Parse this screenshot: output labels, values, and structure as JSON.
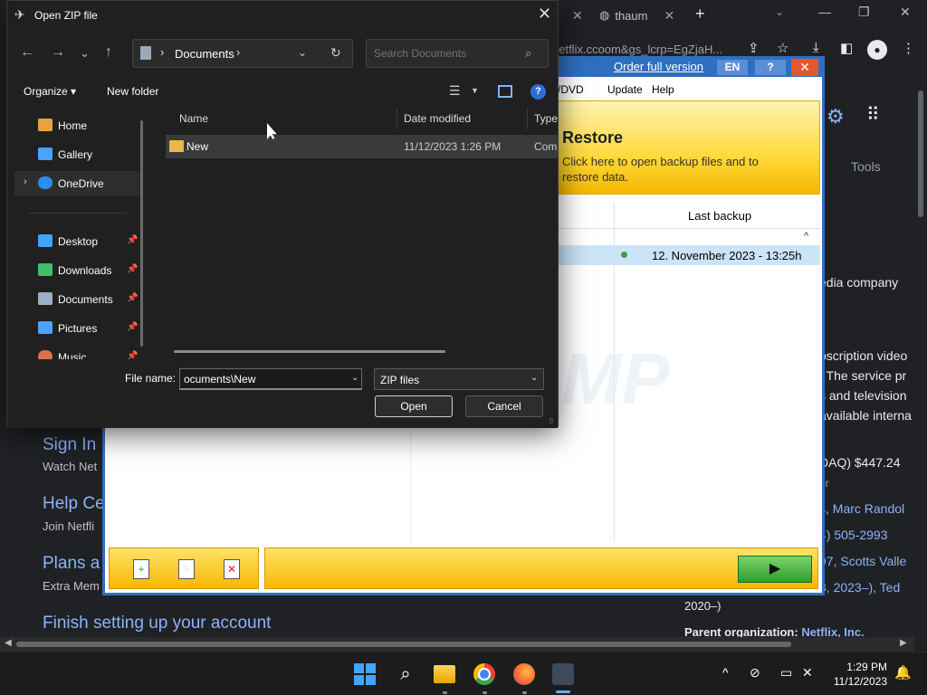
{
  "browser": {
    "tab_x1": "✕",
    "tab_name": "thaum",
    "tab_x2": "✕",
    "new_tab": "+",
    "chevron": "⌄",
    "omnibox": "netflix.ccoom&gs_lcrp=EgZjaH...",
    "win_min": "—",
    "win_max": "❐",
    "win_close": "✕"
  },
  "page": {
    "tools": "Tools",
    "right_texts": [
      "edia company",
      "bscription video",
      ". The service pr",
      "s and television",
      "available interna",
      "DAQ)  $447.24",
      "er",
      "s, Marc Randol",
      "4) 505-2993",
      "97, Scotts Valle",
      "3, 2023–), Ted"
    ],
    "sign_in": "Sign In",
    "sign_in_sub": "Watch Net",
    "help": "Help Ce",
    "help_sub": "Join Netfli",
    "plans": "Plans a",
    "plans_sub": "Extra Mem",
    "finish": "Finish setting up your account",
    "wiki_year": "2020–)",
    "parent_label": "Parent organization:",
    "parent_value": "Netflix, Inc."
  },
  "backup_app": {
    "order_link": "Order full version",
    "lang": "EN",
    "help": "?",
    "close": "✕",
    "menu": [
      "/DVD",
      "Update",
      "Help"
    ],
    "restore_title": "Restore",
    "restore_desc": "Click here to open backup files and to restore data.",
    "col_last_backup": "Last backup",
    "row_last_backup": "12. November 2023 - 13:25h",
    "watermark": "MP",
    "play": "▶"
  },
  "dialog": {
    "title": "Open ZIP file",
    "close": "✕",
    "nav": {
      "back": "←",
      "forward": "→",
      "recent": "⌄",
      "up": "↑"
    },
    "address": {
      "sep": "›",
      "folder": "Documents",
      "dropdown": "⌄",
      "refresh": "↻"
    },
    "search_placeholder": "Search Documents",
    "search_icon": "⌕",
    "organize": "Organize ▾",
    "new_folder": "New folder",
    "help": "?",
    "nav_pane": [
      {
        "label": "Home",
        "color": "#e8a33c"
      },
      {
        "label": "Gallery",
        "color": "#4aa3ff"
      },
      {
        "label": "OneDrive",
        "color": "#2d8cf0",
        "selected": true
      },
      {
        "label": "Desktop",
        "color": "#3ea6ff",
        "pinned": true
      },
      {
        "label": "Downloads",
        "color": "#3fbf6a",
        "pinned": true
      },
      {
        "label": "Documents",
        "color": "#9ab0c8",
        "pinned": true
      },
      {
        "label": "Pictures",
        "color": "#4aa3ff",
        "pinned": true
      },
      {
        "label": "Music",
        "color": "#e0704a",
        "pinned": true
      }
    ],
    "columns": {
      "name": "Name",
      "date": "Date modified",
      "type": "Type"
    },
    "files": [
      {
        "name": "New",
        "date": "11/12/2023 1:26 PM",
        "type": "Com"
      }
    ],
    "file_name_label": "File name:",
    "file_name_value": "ocuments\\New",
    "file_type": "ZIP files",
    "open": "Open",
    "cancel": "Cancel"
  },
  "taskbar": {
    "time": "1:29 PM",
    "date": "11/12/2023"
  }
}
